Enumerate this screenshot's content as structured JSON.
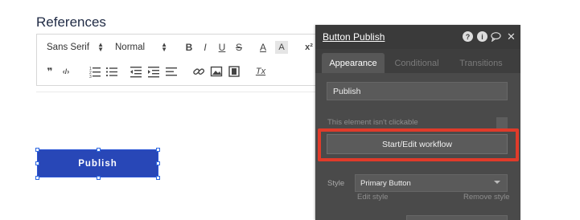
{
  "editor": {
    "section_title": "References",
    "font_family": "Sans Serif",
    "font_size": "Normal",
    "toolbar_glyphs": {
      "bold": "B",
      "italic": "I",
      "underline": "U",
      "strike": "S",
      "text_color": "A",
      "bg_color": "A",
      "superscript": "x²",
      "blockquote": "❞",
      "code": "‹/›",
      "remove_format": "Tx"
    }
  },
  "canvas": {
    "publish_button_label": "Publish"
  },
  "panel": {
    "title": "Button Publish",
    "tabs": [
      "Appearance",
      "Conditional",
      "Transitions"
    ],
    "active_tab": "Appearance",
    "text_field_value": "Publish",
    "not_clickable_label": "This element isn't clickable",
    "workflow_button_label": "Start/Edit workflow",
    "style_label": "Style",
    "style_value": "Primary Button",
    "edit_style_label": "Edit style",
    "remove_style_label": "Remove style"
  },
  "colors": {
    "accent": "#2847b7",
    "highlight": "#e03b2a",
    "panel_bg": "#4a4a4a"
  }
}
